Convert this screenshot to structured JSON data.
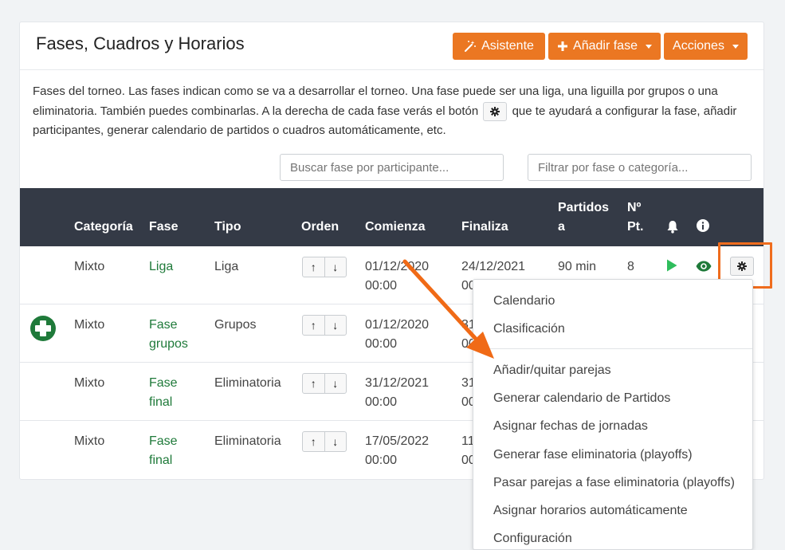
{
  "header": {
    "title": "Fases, Cuadros y Horarios",
    "buttons": {
      "asistente": "Asistente",
      "add_fase": "Añadir fase",
      "acciones": "Acciones"
    }
  },
  "description": {
    "part1": "Fases del torneo. Las fases indican como se va a desarrollar el torneo. Una fase puede ser una liga, una liguilla por grupos o una eliminatoria. También puedes combinarlas. A la derecha de cada fase verás el botón",
    "part2": "que te ayudará a configurar la fase, añadir participantes, generar calendario de partidos o cuadros automáticamente, etc."
  },
  "filters": {
    "search_placeholder": "Buscar fase por participante...",
    "filter_placeholder": "Filtrar por fase o categoría..."
  },
  "table": {
    "headers": {
      "categoria": "Categoría",
      "fase": "Fase",
      "tipo": "Tipo",
      "orden": "Orden",
      "comienza": "Comienza",
      "finaliza": "Finaliza",
      "partidos_1": "Partidos",
      "partidos_2": "a",
      "npt_1": "Nº",
      "npt_2": "Pt."
    },
    "rows": [
      {
        "categoria": "Mixto",
        "fase1": "Liga",
        "fase2": "",
        "tipo": "Liga",
        "comienza1": "01/12/2020",
        "comienza2": "00:00",
        "finaliza1": "24/12/2021",
        "finaliza2": "00",
        "partidos": "90 min",
        "npt": "8"
      },
      {
        "categoria": "Mixto",
        "fase1": "Fase",
        "fase2": "grupos",
        "tipo": "Grupos",
        "comienza1": "01/12/2020",
        "comienza2": "00:00",
        "finaliza1": "31",
        "finaliza2": "00"
      },
      {
        "categoria": "Mixto",
        "fase1": "Fase",
        "fase2": "final",
        "tipo": "Eliminatoria",
        "comienza1": "31/12/2021",
        "comienza2": "00:00",
        "finaliza1": "31",
        "finaliza2": "00"
      },
      {
        "categoria": "Mixto",
        "fase1": "Fase",
        "fase2": "final",
        "tipo": "Eliminatoria",
        "comienza1": "17/05/2022",
        "comienza2": "00:00",
        "finaliza1": "11",
        "finaliza2": "00"
      }
    ]
  },
  "dropdown": {
    "items": [
      "Calendario",
      "Clasificación",
      "Añadir/quitar parejas",
      "Generar calendario de Partidos",
      "Asignar fechas de jornadas",
      "Generar fase eliminatoria (playoffs)",
      "Pasar parejas a fase eliminatoria (playoffs)",
      "Asignar horarios automáticamente",
      "Configuración"
    ]
  },
  "colors": {
    "accent_orange": "#eb7722",
    "table_header": "#343a46",
    "green": "#1f7a3a"
  }
}
